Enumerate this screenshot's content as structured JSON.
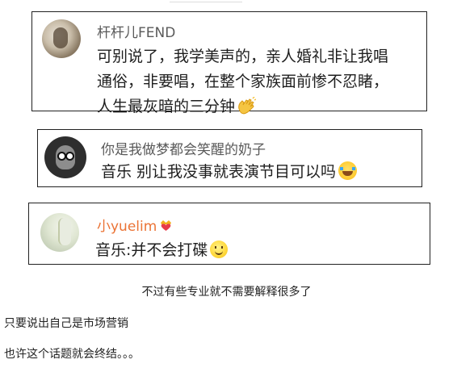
{
  "comments": [
    {
      "username": "杆杆儿FEND",
      "username_color": "#5a5a5a",
      "lines": [
        "可别说了，我学美声的，亲人婚礼非让我唱",
        "通俗，非要唱，在整个家族面前惨不忍睹，",
        "人生最灰暗的三分钟"
      ],
      "emoji": "waving-hand-emoji"
    },
    {
      "username": "你是我做梦都会笑醒的奶子",
      "username_color": "#5a5a5a",
      "lines": [
        "音乐 别让我没事就表演节目可以吗"
      ],
      "emoji": "laughing-tears-emoji"
    },
    {
      "username": "小yuelim",
      "username_color": "#eb7335",
      "badge": "crown-heart-badge-icon",
      "lines": [
        "音乐:并不会打碟"
      ],
      "emoji": "smile-emoji"
    }
  ],
  "captions": [
    "不过有些专业就不需要解释很多了",
    "只要说出自己是市场营销",
    "也许这个话题就会终结。。。"
  ]
}
